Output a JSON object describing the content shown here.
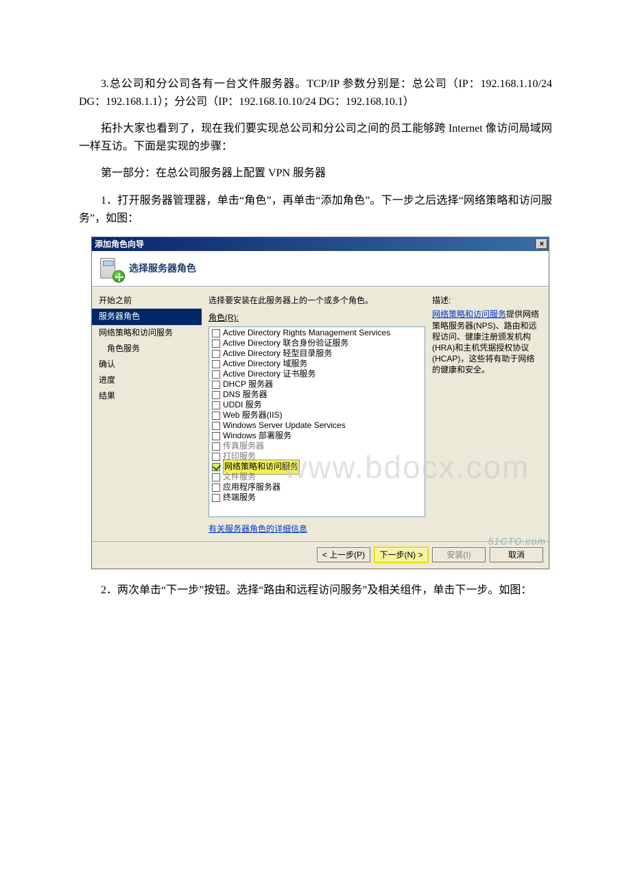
{
  "doc": {
    "p1": "3.总公司和分公司各有一台文件服务器。TCP/IP 参数分别是：总公司（IP：192.168.1.10/24 DG：192.168.1.1）；分公司（IP：192.168.10.10/24 DG：192.168.10.1）",
    "p2": "拓扑大家也看到了，现在我们要实现总公司和分公司之间的员工能够跨 Internet 像访问局域网一样互访。下面是实现的步骤：",
    "p3": "第一部分：在总公司服务器上配置 VPN 服务器",
    "p4": "1．打开服务器管理器，单击“角色”，再单击“添加角色”。下一步之后选择“网络策略和访问服务”，如图：",
    "p5": "2．两次单击“下一步”按钮。选择“路由和远程访问服务”及相关组件，单击下一步。如图："
  },
  "wizard": {
    "title": "添加角色向导",
    "header": "选择服务器角色",
    "sidebar": {
      "items": [
        "开始之前",
        "服务器角色",
        "网络策略和访问服务",
        "角色服务",
        "确认",
        "进度",
        "结果"
      ]
    },
    "content": {
      "instr": "选择要安装在此服务器上的一个或多个角色。",
      "roles_label": "角色(R):",
      "roles": [
        "Active Directory Rights Management Services",
        "Active Directory 联合身份验证服务",
        "Active Directory 轻型目录服务",
        "Active Directory 域服务",
        "Active Directory 证书服务",
        "DHCP 服务器",
        "DNS 服务器",
        "UDDI 服务",
        "Web 服务器(IIS)",
        "Windows Server Update Services",
        "Windows 部署服务",
        "传真服务器",
        "打印服务",
        "网络策略和访问服务",
        "文件服务",
        "应用程序服务器",
        "终端服务"
      ],
      "more_link": "有关服务器角色的详细信息"
    },
    "desc": {
      "label": "描述:",
      "link": "网络策略和访问服务",
      "text": "提供网络策略服务器(NPS)、路由和远程访问、健康注册颁发机构(HRA)和主机凭据授权协议(HCAP)，这些将有助于网络的健康和安全。"
    },
    "buttons": {
      "back": "< 上一步(P)",
      "next": "下一步(N) >",
      "install": "安装(I)",
      "cancel": "取消"
    },
    "watermark": "www.bdocx.com",
    "cto": "51CTO.com"
  }
}
